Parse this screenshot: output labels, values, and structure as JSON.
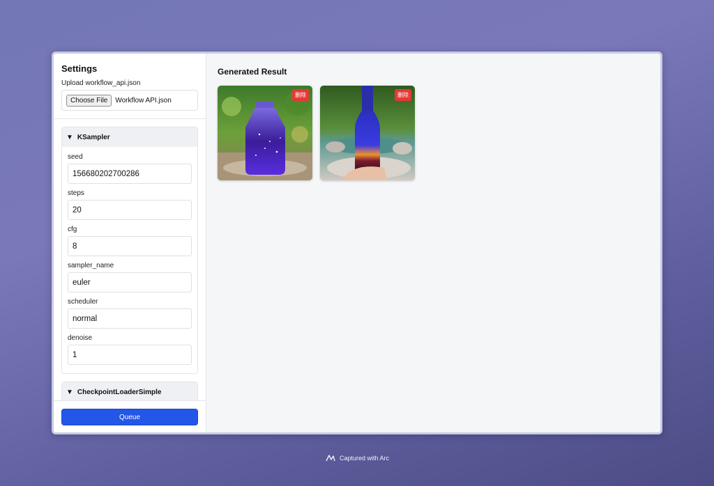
{
  "sidebar": {
    "title": "Settings",
    "upload_label": "Upload workflow_api.json",
    "file_button": "Choose File",
    "file_name": "Workflow API.json",
    "nodes": [
      {
        "name": "KSampler",
        "fields": [
          {
            "label": "seed",
            "value": "156680202700286"
          },
          {
            "label": "steps",
            "value": "20"
          },
          {
            "label": "cfg",
            "value": "8"
          },
          {
            "label": "sampler_name",
            "value": "euler"
          },
          {
            "label": "scheduler",
            "value": "normal"
          },
          {
            "label": "denoise",
            "value": "1"
          }
        ]
      },
      {
        "name": "CheckpointLoaderSimple"
      }
    ],
    "queue_label": "Queue"
  },
  "main": {
    "title": "Generated Result",
    "images": [
      {
        "icon": "purple-jar-image",
        "delete_label": "删除"
      },
      {
        "icon": "blue-bottle-image",
        "delete_label": "删除"
      }
    ]
  },
  "footer": {
    "text": "Captured with Arc",
    "icon": "arc-logo-icon"
  },
  "colors": {
    "accent": "#2257e8",
    "delete": "#e53935"
  }
}
